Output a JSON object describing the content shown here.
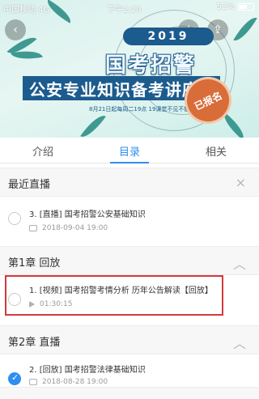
{
  "status_bar": {
    "carrier": "中国移动 4G",
    "time": "下午2:29",
    "battery": "52%"
  },
  "banner": {
    "year": "2019",
    "title_line1": "国考招警",
    "title_line2": "公安专业知识备考讲座",
    "date_text": "8月21日起每周二19点  19课堂不见不散",
    "seal_text": "已报名"
  },
  "tabs": [
    {
      "label": "介绍",
      "active": false
    },
    {
      "label": "目录",
      "active": true
    },
    {
      "label": "相关",
      "active": false
    }
  ],
  "sections": {
    "recent": {
      "title": "最近直播",
      "items": [
        {
          "title": "3. [直播] 国考招警公安基础知识",
          "meta": "2018-09-04 19:00"
        }
      ]
    },
    "chapter1": {
      "title": "第1章  回放",
      "items": [
        {
          "title": "1. [视频] 国考招警考情分析 历年公告解读【回放】",
          "meta": "01:30:15"
        }
      ]
    },
    "chapter2": {
      "title": "第2章  直播",
      "items": [
        {
          "title": "2. [回放] 国考招警法律基础知识",
          "meta": "2018-08-28 19:00",
          "checked": true
        }
      ]
    }
  }
}
